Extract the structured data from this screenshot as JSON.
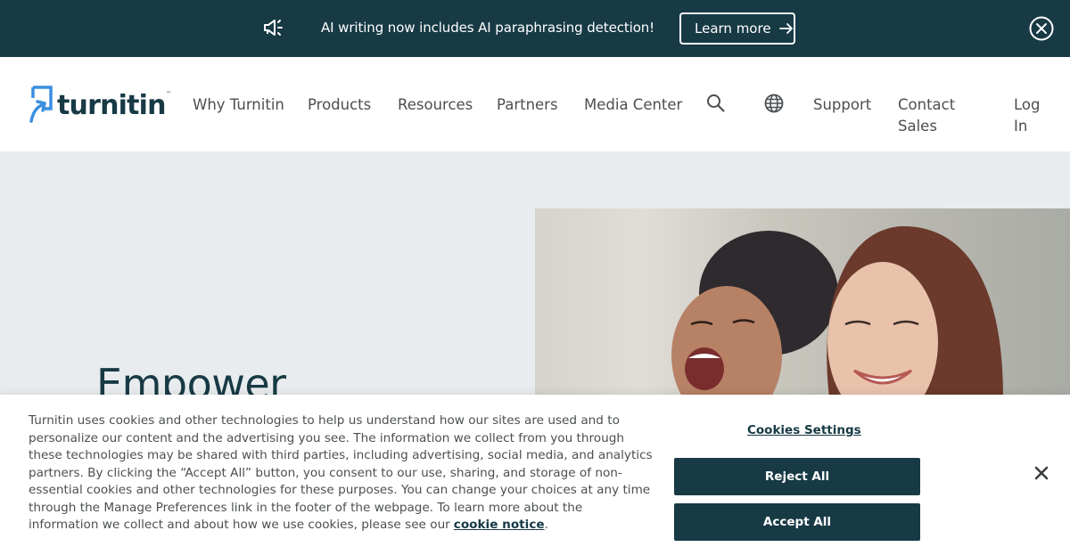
{
  "announcement": {
    "icon": "megaphone-icon",
    "message": "AI writing now includes AI paraphrasing detection!",
    "cta_label": "Learn more",
    "cta_icon": "arrow-right-icon",
    "close_icon": "close-circle-icon"
  },
  "header": {
    "logo_text": "turnitin",
    "logo_tm": "™",
    "nav": [
      {
        "label": "Why Turnitin"
      },
      {
        "label": "Products"
      },
      {
        "label": "Resources"
      },
      {
        "label": "Partners"
      },
      {
        "label": "Media Center"
      }
    ],
    "search_icon": "search-icon",
    "language_icon": "globe-icon",
    "support_label": "Support",
    "contact_label": "Contact Sales",
    "login_label": "Log In"
  },
  "hero": {
    "title": "Empower"
  },
  "cookie_banner": {
    "text": "Turnitin uses cookies and other technologies to help us understand how our sites are used and to personalize our content and the advertising you see. The information we collect from you through these technologies may be shared with third parties, including advertising, social media, and analytics partners. By clicking the “Accept All” button, you consent to our use, sharing, and storage of non-essential cookies and other technologies for these purposes. You can change your choices at any time through the Manage Preferences link in the footer of the webpage. To learn more about the information we collect and about how we use cookies, please see our",
    "link_label": "cookie notice",
    "settings_label": "Cookies Settings",
    "reject_label": "Reject All",
    "accept_label": "Accept All",
    "close_icon": "close-icon"
  },
  "colors": {
    "brand_dark": "#173a45",
    "brand_blue": "#3b8fe0",
    "hero_bg": "#e8ecee",
    "nav_text": "#4b4f52"
  }
}
